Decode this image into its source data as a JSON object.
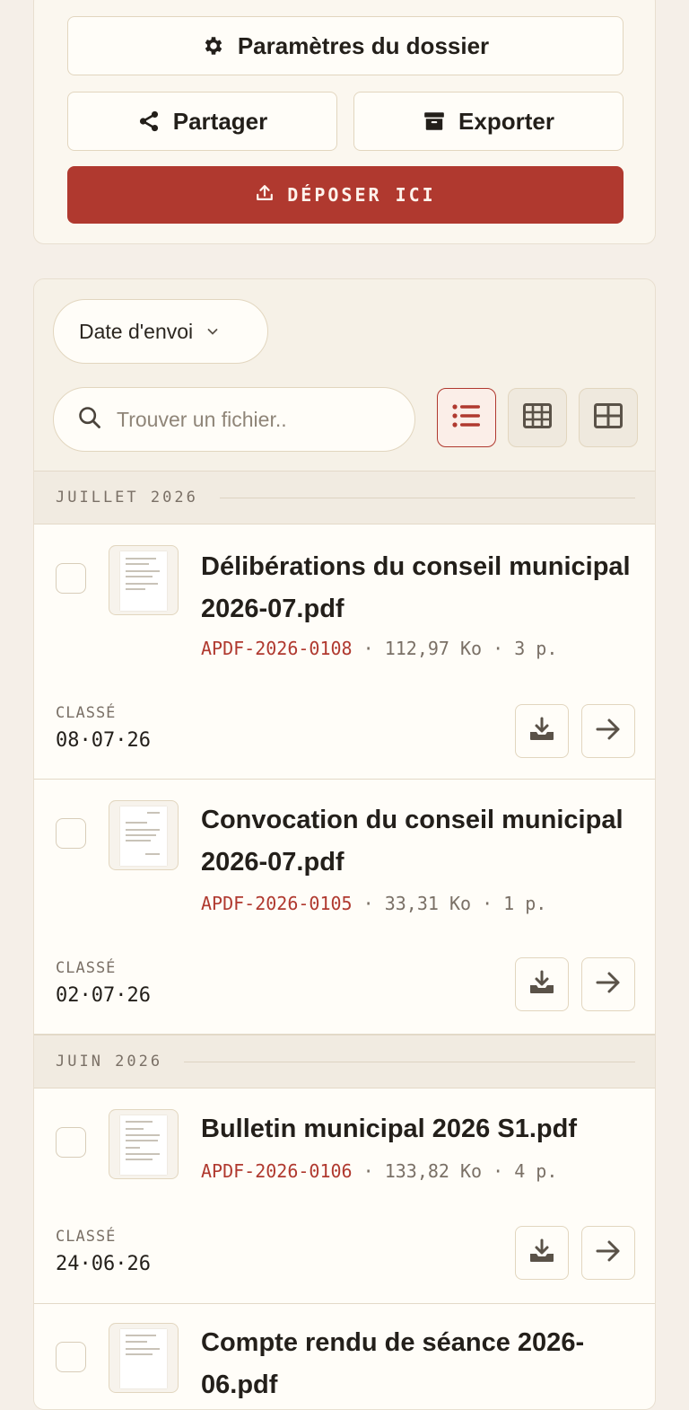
{
  "actions": {
    "settings_label": "Paramètres du dossier",
    "share_label": "Partager",
    "export_label": "Exporter",
    "drop_label": "DÉPOSER ICI",
    "settings_icon": "gear-icon",
    "share_icon": "share-icon",
    "export_icon": "archive-icon",
    "drop_icon": "upload-icon",
    "accent_color": "#b0392f"
  },
  "toolbar": {
    "sort_label": "Date d'envoi",
    "search_placeholder": "Trouver un fichier..",
    "search_value": "",
    "views": [
      "list",
      "table",
      "grid"
    ],
    "active_view": "list"
  },
  "groups": [
    {
      "label": "JUILLET 2026",
      "files": [
        {
          "title": "Délibérations du conseil municipal 2026-07.pdf",
          "ref": "APDF-2026-0108",
          "info": " · 112,97 Ko · 3 p.",
          "classed_label": "CLASSÉ",
          "date": "08·07·26"
        },
        {
          "title": "Convocation du conseil municipal 2026-07.pdf",
          "ref": "APDF-2026-0105",
          "info": " · 33,31 Ko · 1 p.",
          "classed_label": "CLASSÉ",
          "date": "02·07·26"
        }
      ]
    },
    {
      "label": "JUIN 2026",
      "files": [
        {
          "title": "Bulletin municipal 2026 S1.pdf",
          "ref": "APDF-2026-0106",
          "info": " · 133,82 Ko · 4 p.",
          "classed_label": "CLASSÉ",
          "date": "24·06·26"
        },
        {
          "title": "Compte rendu de séance 2026-06.pdf",
          "ref": "",
          "info": "",
          "classed_label": "",
          "date": ""
        }
      ]
    }
  ]
}
